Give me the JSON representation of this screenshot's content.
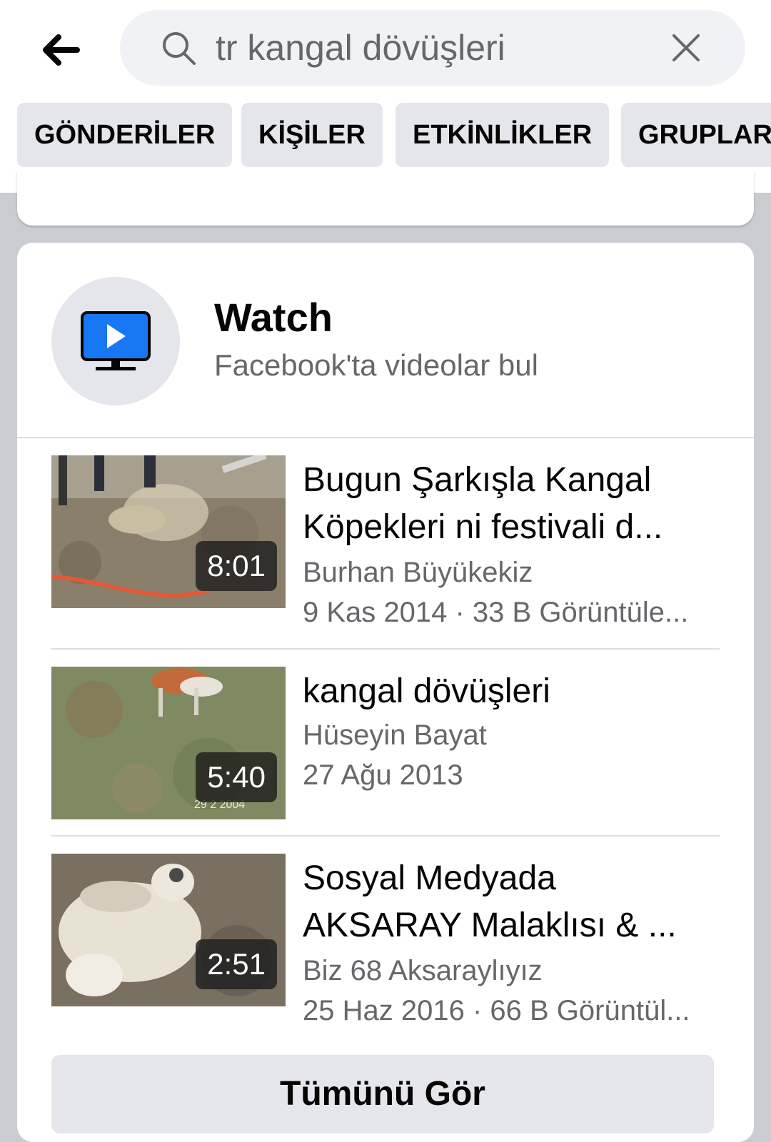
{
  "search": {
    "query": "tr kangal dövüşleri",
    "back_icon": "arrow-left-icon",
    "search_icon": "search-icon",
    "clear_icon": "close-icon"
  },
  "filters": [
    "GÖNDERİLER",
    "KİŞİLER",
    "ETKİNLİKLER",
    "GRUPLAR"
  ],
  "watch": {
    "title": "Watch",
    "subtitle": "Facebook'ta videolar bul",
    "icon": "tv-play-icon",
    "accent": "#1877f2"
  },
  "videos": [
    {
      "title_line1": "Bugun Şarkışla Kangal",
      "title_line2": "Köpekleri  ni festivali d...",
      "author": "Burhan Büyükekiz",
      "meta": "9 Kas 2014 · 33 B Görüntüle...",
      "duration": "8:01"
    },
    {
      "title_line1": "kangal dövüşleri",
      "title_line2": "",
      "author": "Hüseyin Bayat",
      "meta": "27 Ağu 2013",
      "duration": "5:40",
      "overlay_text": "29 2 2004"
    },
    {
      "title_line1": "Sosyal Medyada",
      "title_line2": "AKSARAY Malaklısı & ...",
      "author": "Biz 68 Aksaraylıyız",
      "meta": "25 Haz 2016 · 66 B Görüntül...",
      "duration": "2:51"
    }
  ],
  "see_all": "Tümünü Gör"
}
